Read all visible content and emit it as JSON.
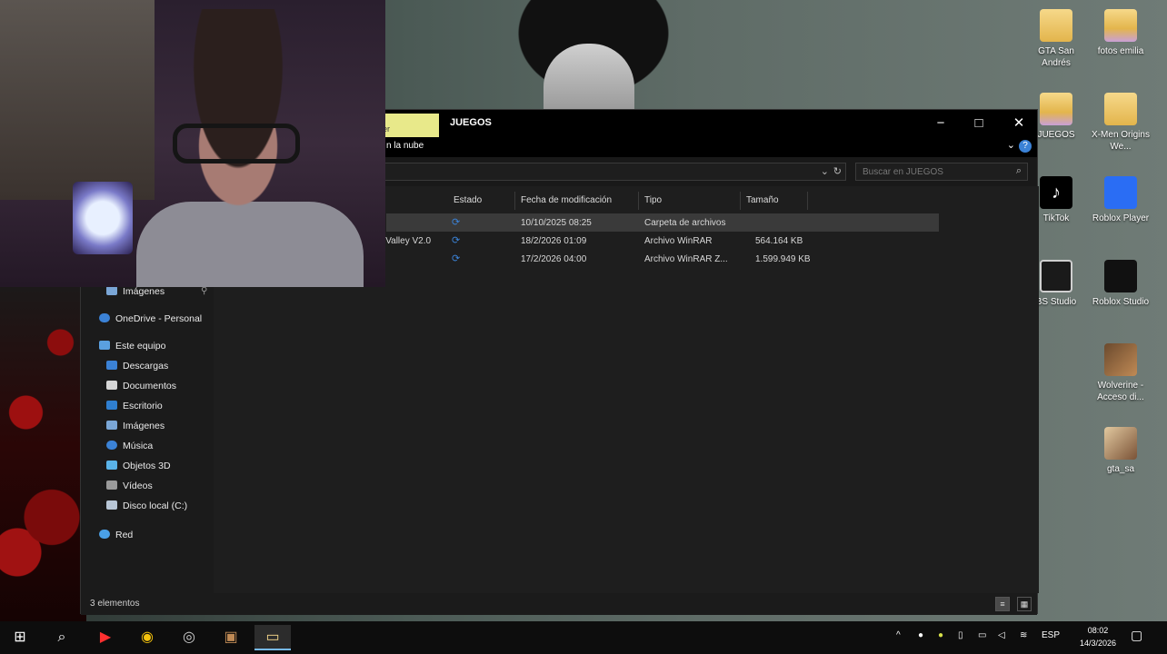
{
  "window": {
    "title": "JUEGOS",
    "ribbon_text": "n la nube",
    "search_placeholder": "Buscar en JUEGOS",
    "nav_items": {
      "imagenes_quick": "Imágenes",
      "onedrive": "OneDrive - Personal",
      "este_equipo": "Este equipo",
      "descargas": "Descargas",
      "documentos": "Documentos",
      "escritorio": "Escritorio",
      "imagenes": "Imágenes",
      "musica": "Música",
      "objetos3d": "Objetos 3D",
      "videos": "Vídeos",
      "disco": "Disco local (C:)",
      "red": "Red"
    },
    "columns": {
      "estado": "Estado",
      "fecha": "Fecha de modificación",
      "tipo": "Tipo",
      "tamano": "Tamaño"
    },
    "files": [
      {
        "name": "",
        "date": "10/10/2025 08:25",
        "type": "Carpeta de archivos",
        "size": ""
      },
      {
        "name": "ll Valley V2.0",
        "date": "18/2/2026 01:09",
        "type": "Archivo WinRAR",
        "size": "564.164 KB"
      },
      {
        "name": "",
        "date": "17/2/2026 04:00",
        "type": "Archivo WinRAR Z...",
        "size": "1.599.949 KB"
      }
    ],
    "status": "3 elementos"
  },
  "desktop_icons": {
    "gta_san_andreas": "GTA San Andrés",
    "fotos_emilia": "fotos emilia",
    "juegos": "JUEGOS",
    "xmen": "X-Men Origins We...",
    "tiktok": "TikTok",
    "roblox_player": "Roblox Player",
    "obs": "BS Studio",
    "roblox_studio": "Roblox Studio",
    "wolverine": "Wolverine - Acceso di...",
    "gta_sa": "gta_sa"
  },
  "taskbar": {
    "language": "ESP",
    "time": "08:02",
    "date": "14/3/2026"
  },
  "colors": {
    "window_bg": "#1f1f1f",
    "accent": "#3b82d6",
    "title_highlight": "#e8e98a"
  }
}
